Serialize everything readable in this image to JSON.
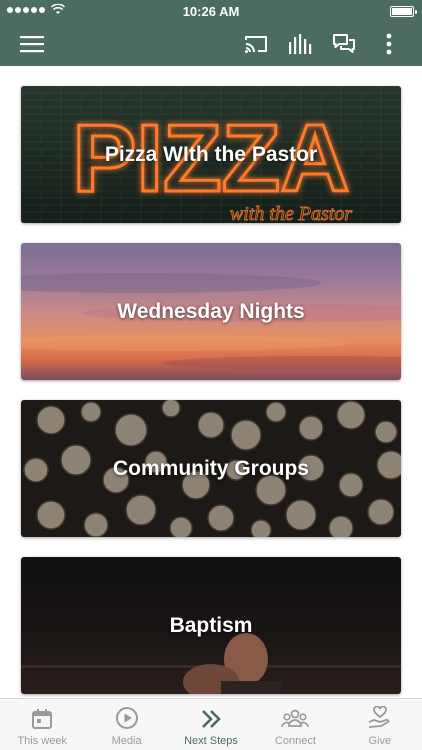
{
  "status_bar": {
    "time": "10:26 AM"
  },
  "app_bar": {
    "menu_icon": "hamburger-menu-icon",
    "actions": [
      "cast-icon",
      "audio-equalizer-icon",
      "chat-icon",
      "more-vertical-icon"
    ]
  },
  "cards": [
    {
      "title": "Pizza WIth the Pastor",
      "background_text": "PIZZA",
      "background_script": "with the Pastor"
    },
    {
      "title": "Wednesday Nights"
    },
    {
      "title": "Community Groups"
    },
    {
      "title": "Baptism"
    }
  ],
  "tabs": [
    {
      "label": "This week",
      "icon": "calendar-icon",
      "active": false
    },
    {
      "label": "Media",
      "icon": "play-circle-icon",
      "active": false
    },
    {
      "label": "Next Steps",
      "icon": "double-chevron-right-icon",
      "active": true
    },
    {
      "label": "Connect",
      "icon": "people-group-icon",
      "active": false
    },
    {
      "label": "Give",
      "icon": "heart-hand-icon",
      "active": false
    }
  ],
  "colors": {
    "app_bar": "#4c6b63",
    "active_tab": "#4c6b63",
    "inactive_tab": "#9a9a9a",
    "neon": "#ff8a3a"
  }
}
